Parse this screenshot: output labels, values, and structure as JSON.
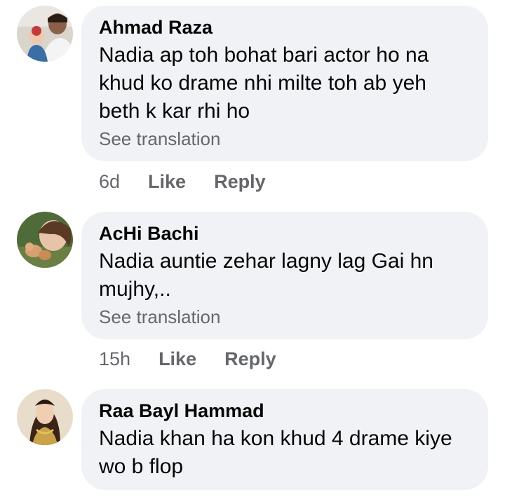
{
  "comments": [
    {
      "author": "Ahmad Raza",
      "text": "Nadia ap toh bohat bari actor ho na khud ko drame nhi milte toh ab yeh beth k kar rhi ho",
      "see_translation": "See translation",
      "time": "6d",
      "like": "Like",
      "reply": "Reply",
      "avatar_icon": "profile-photo-icon"
    },
    {
      "author": "AcHi Bachi",
      "text": "Nadia auntie zehar lagny lag Gai hn mujhy,..",
      "see_translation": "See translation",
      "time": "15h",
      "like": "Like",
      "reply": "Reply",
      "avatar_icon": "profile-photo-icon"
    },
    {
      "author": "Raa Bayl Hammad",
      "text": "Nadia khan ha kon khud 4 drame kiye wo b flop",
      "avatar_icon": "profile-photo-icon"
    }
  ],
  "colors": {
    "bubble": "#f0f2f5",
    "text": "#050505",
    "secondary": "#65676b"
  }
}
